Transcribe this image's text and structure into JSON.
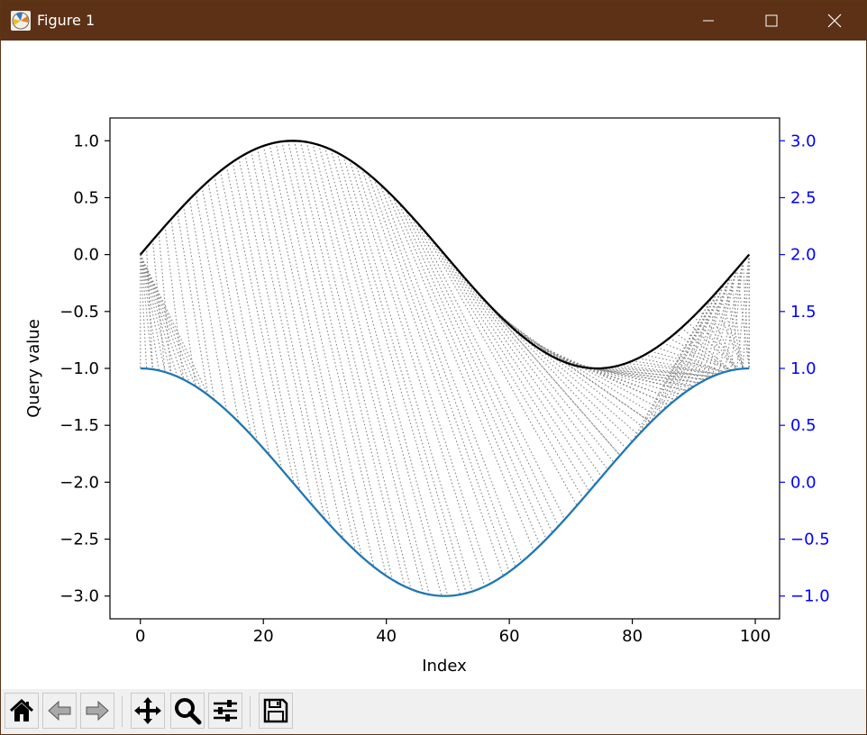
{
  "window": {
    "title": "Figure 1",
    "icons": [
      "matplotlib-figure-icon",
      "minimize-icon",
      "maximize-icon",
      "close-icon"
    ]
  },
  "toolbar": {
    "buttons": [
      {
        "name": "home-button",
        "icon": "home-icon"
      },
      {
        "name": "back-button",
        "icon": "back-arrow-icon"
      },
      {
        "name": "forward-button",
        "icon": "forward-arrow-icon"
      },
      {
        "name": "pan-button",
        "icon": "move-icon"
      },
      {
        "name": "zoom-button",
        "icon": "magnifier-icon"
      },
      {
        "name": "configure-subplots-button",
        "icon": "sliders-icon"
      },
      {
        "name": "save-button",
        "icon": "floppy-disk-icon"
      }
    ]
  },
  "chart_data": {
    "type": "line",
    "title": "",
    "xlabel": "Index",
    "ylabel": "Query value",
    "xlim": [
      -4.95,
      103.95
    ],
    "ylim": [
      -3.2,
      1.2
    ],
    "ylim_right": [
      -1.2,
      3.2
    ],
    "x_ticks": [
      0,
      20,
      40,
      60,
      80,
      100
    ],
    "x_tick_labels": [
      "0",
      "20",
      "40",
      "60",
      "80",
      "100"
    ],
    "y_ticks": [
      1.0,
      0.5,
      0.0,
      -0.5,
      -1.0,
      -1.5,
      -2.0,
      -2.5,
      -3.0
    ],
    "y_tick_labels": [
      "1.0",
      "0.5",
      "0.0",
      "−0.5",
      "−1.0",
      "−1.5",
      "−2.0",
      "−2.5",
      "−3.0"
    ],
    "y_right_ticks": [
      3.0,
      2.5,
      2.0,
      1.5,
      1.0,
      0.5,
      0.0,
      -0.5,
      -1.0
    ],
    "y_right_tick_labels": [
      "3.0",
      "2.5",
      "2.0",
      "1.5",
      "1.0",
      "0.5",
      "0.0",
      "−0.5",
      "−1.0"
    ],
    "grid": false,
    "series": [
      {
        "color": "#000000",
        "description": "query = sin(2*pi*i/99), i = 0..99",
        "function": "sin",
        "n": 100
      },
      {
        "color": "#1f77b4",
        "description": "reference = cos(2*pi*i/99) - 2 (left axis) / cos(2*pi*i/99) on right axis, i = 0..99",
        "function": "cos_minus_2",
        "n": 100
      }
    ],
    "alignment_lines": {
      "style": "dotted",
      "color": "#808080"
    },
    "colors": {
      "right_axis": "#0000ff",
      "axes": "#000000"
    }
  }
}
